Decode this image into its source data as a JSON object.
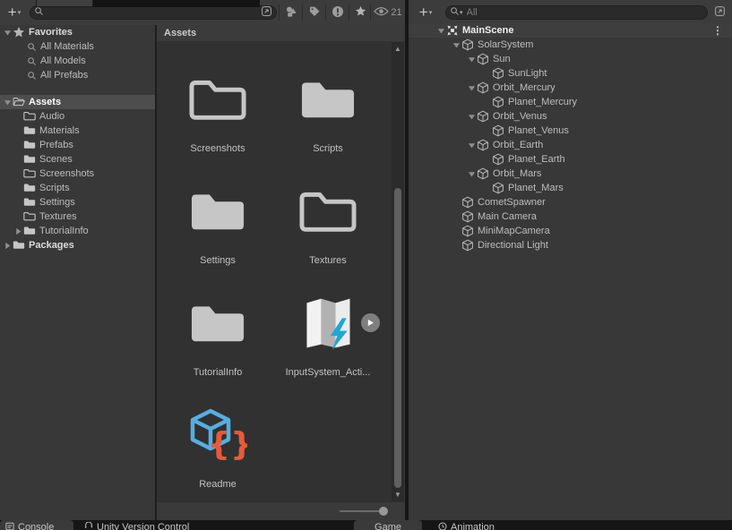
{
  "project": {
    "search_value": "",
    "eye_count": "21",
    "toolbar_icons": [
      "add-icon",
      "search-icon",
      "open-window-icon",
      "search-by-type-icon",
      "label-tag-icon",
      "alert-icon",
      "favorite-star-icon",
      "eye-icon"
    ],
    "favorites": {
      "label": "Favorites",
      "icon": "star-icon",
      "state": "expanded",
      "items": [
        {
          "label": "All Materials",
          "icon": "search-icon"
        },
        {
          "label": "All Models",
          "icon": "search-icon"
        },
        {
          "label": "All Prefabs",
          "icon": "search-icon"
        }
      ]
    },
    "tree": [
      {
        "label": "Assets",
        "icon": "folder-open-icon",
        "state": "expanded",
        "root": true,
        "selected": true,
        "bold": true
      },
      {
        "label": "Audio",
        "icon": "folder-outline-icon"
      },
      {
        "label": "Materials",
        "icon": "folder-icon"
      },
      {
        "label": "Prefabs",
        "icon": "folder-icon"
      },
      {
        "label": "Scenes",
        "icon": "folder-icon"
      },
      {
        "label": "Screenshots",
        "icon": "folder-outline-icon"
      },
      {
        "label": "Scripts",
        "icon": "folder-icon"
      },
      {
        "label": "Settings",
        "icon": "folder-icon"
      },
      {
        "label": "Textures",
        "icon": "folder-outline-icon"
      },
      {
        "label": "TutorialInfo",
        "icon": "folder-icon",
        "state": "collapsed",
        "subroot": true
      },
      {
        "label": "Packages",
        "icon": "folder-icon",
        "state": "collapsed",
        "root": true,
        "bold": true
      }
    ],
    "breadcrumb": "Assets",
    "grid_items": [
      {
        "label": "Screenshots",
        "icon": "folder-outline"
      },
      {
        "label": "Scripts",
        "icon": "folder"
      },
      {
        "label": "Settings",
        "icon": "folder"
      },
      {
        "label": "Textures",
        "icon": "folder-outline"
      },
      {
        "label": "TutorialInfo",
        "icon": "folder"
      },
      {
        "label": "InputSystem_Acti...",
        "icon": "input-actions",
        "badge": "play"
      },
      {
        "label": "Readme",
        "icon": "readme"
      }
    ]
  },
  "hierarchy": {
    "search_placeholder": "All",
    "rows": [
      {
        "label": "MainScene",
        "level": 0,
        "icon": "scene-icon",
        "state": "expanded",
        "bold": true,
        "menu": true
      },
      {
        "label": "SolarSystem",
        "level": 1,
        "icon": "cube-icon",
        "state": "expanded"
      },
      {
        "label": "Sun",
        "level": 2,
        "icon": "cube-icon",
        "state": "expanded"
      },
      {
        "label": "SunLight",
        "level": 3,
        "icon": "cube-icon"
      },
      {
        "label": "Orbit_Mercury",
        "level": 2,
        "icon": "cube-icon",
        "state": "expanded"
      },
      {
        "label": "Planet_Mercury",
        "level": 3,
        "icon": "cube-icon"
      },
      {
        "label": "Orbit_Venus",
        "level": 2,
        "icon": "cube-icon",
        "state": "expanded"
      },
      {
        "label": "Planet_Venus",
        "level": 3,
        "icon": "cube-icon"
      },
      {
        "label": "Orbit_Earth",
        "level": 2,
        "icon": "cube-icon",
        "state": "expanded"
      },
      {
        "label": "Planet_Earth",
        "level": 3,
        "icon": "cube-icon"
      },
      {
        "label": "Orbit_Mars",
        "level": 2,
        "icon": "cube-icon",
        "state": "expanded"
      },
      {
        "label": "Planet_Mars",
        "level": 3,
        "icon": "cube-icon"
      },
      {
        "label": "CometSpawner",
        "level": 1,
        "icon": "cube-icon"
      },
      {
        "label": "Main Camera",
        "level": 1,
        "icon": "cube-icon"
      },
      {
        "label": "MiniMapCamera",
        "level": 1,
        "icon": "cube-icon"
      },
      {
        "label": "Directional Light",
        "level": 1,
        "icon": "cube-icon"
      }
    ]
  },
  "bottom_tabs": [
    {
      "label": "Console",
      "icon": "console-icon",
      "active": true
    },
    {
      "label": "Unity Version Control",
      "icon": "version-control-icon"
    },
    {
      "label": "Game",
      "tab": true
    },
    {
      "label": "Animation",
      "icon": "animation-icon"
    }
  ],
  "colors": {
    "readme_blue": "#56aee0",
    "readme_orange": "#e8593b",
    "bolt_cyan": "#1fa7d4",
    "folder_gray": "#c6c6c6"
  }
}
